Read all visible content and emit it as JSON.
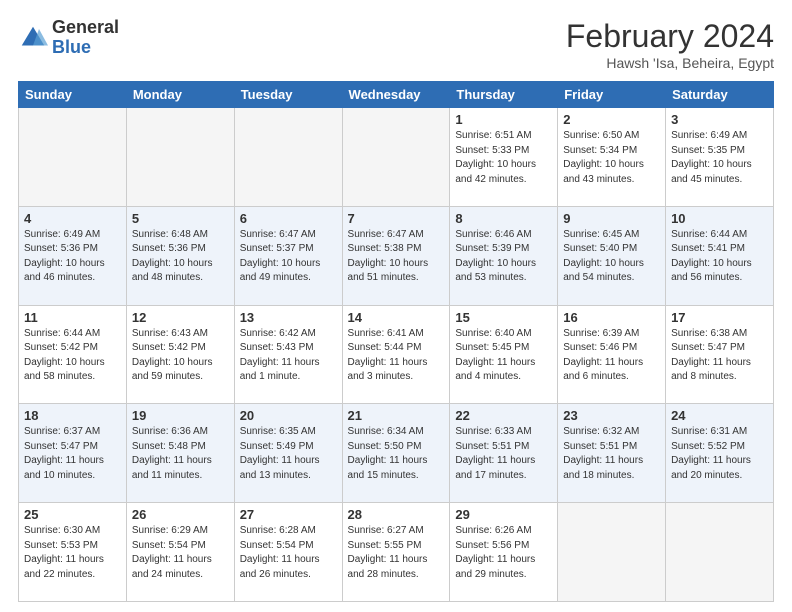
{
  "header": {
    "logo_general": "General",
    "logo_blue": "Blue",
    "month_year": "February 2024",
    "location": "Hawsh 'Isa, Beheira, Egypt"
  },
  "weekdays": [
    "Sunday",
    "Monday",
    "Tuesday",
    "Wednesday",
    "Thursday",
    "Friday",
    "Saturday"
  ],
  "weeks": [
    [
      {
        "day": "",
        "empty": true
      },
      {
        "day": "",
        "empty": true
      },
      {
        "day": "",
        "empty": true
      },
      {
        "day": "",
        "empty": true
      },
      {
        "day": "1",
        "sunrise": "6:51 AM",
        "sunset": "5:33 PM",
        "daylight": "10 hours and 42 minutes."
      },
      {
        "day": "2",
        "sunrise": "6:50 AM",
        "sunset": "5:34 PM",
        "daylight": "10 hours and 43 minutes."
      },
      {
        "day": "3",
        "sunrise": "6:49 AM",
        "sunset": "5:35 PM",
        "daylight": "10 hours and 45 minutes."
      }
    ],
    [
      {
        "day": "4",
        "sunrise": "6:49 AM",
        "sunset": "5:36 PM",
        "daylight": "10 hours and 46 minutes."
      },
      {
        "day": "5",
        "sunrise": "6:48 AM",
        "sunset": "5:36 PM",
        "daylight": "10 hours and 48 minutes."
      },
      {
        "day": "6",
        "sunrise": "6:47 AM",
        "sunset": "5:37 PM",
        "daylight": "10 hours and 49 minutes."
      },
      {
        "day": "7",
        "sunrise": "6:47 AM",
        "sunset": "5:38 PM",
        "daylight": "10 hours and 51 minutes."
      },
      {
        "day": "8",
        "sunrise": "6:46 AM",
        "sunset": "5:39 PM",
        "daylight": "10 hours and 53 minutes."
      },
      {
        "day": "9",
        "sunrise": "6:45 AM",
        "sunset": "5:40 PM",
        "daylight": "10 hours and 54 minutes."
      },
      {
        "day": "10",
        "sunrise": "6:44 AM",
        "sunset": "5:41 PM",
        "daylight": "10 hours and 56 minutes."
      }
    ],
    [
      {
        "day": "11",
        "sunrise": "6:44 AM",
        "sunset": "5:42 PM",
        "daylight": "10 hours and 58 minutes."
      },
      {
        "day": "12",
        "sunrise": "6:43 AM",
        "sunset": "5:42 PM",
        "daylight": "10 hours and 59 minutes."
      },
      {
        "day": "13",
        "sunrise": "6:42 AM",
        "sunset": "5:43 PM",
        "daylight": "11 hours and 1 minute."
      },
      {
        "day": "14",
        "sunrise": "6:41 AM",
        "sunset": "5:44 PM",
        "daylight": "11 hours and 3 minutes."
      },
      {
        "day": "15",
        "sunrise": "6:40 AM",
        "sunset": "5:45 PM",
        "daylight": "11 hours and 4 minutes."
      },
      {
        "day": "16",
        "sunrise": "6:39 AM",
        "sunset": "5:46 PM",
        "daylight": "11 hours and 6 minutes."
      },
      {
        "day": "17",
        "sunrise": "6:38 AM",
        "sunset": "5:47 PM",
        "daylight": "11 hours and 8 minutes."
      }
    ],
    [
      {
        "day": "18",
        "sunrise": "6:37 AM",
        "sunset": "5:47 PM",
        "daylight": "11 hours and 10 minutes."
      },
      {
        "day": "19",
        "sunrise": "6:36 AM",
        "sunset": "5:48 PM",
        "daylight": "11 hours and 11 minutes."
      },
      {
        "day": "20",
        "sunrise": "6:35 AM",
        "sunset": "5:49 PM",
        "daylight": "11 hours and 13 minutes."
      },
      {
        "day": "21",
        "sunrise": "6:34 AM",
        "sunset": "5:50 PM",
        "daylight": "11 hours and 15 minutes."
      },
      {
        "day": "22",
        "sunrise": "6:33 AM",
        "sunset": "5:51 PM",
        "daylight": "11 hours and 17 minutes."
      },
      {
        "day": "23",
        "sunrise": "6:32 AM",
        "sunset": "5:51 PM",
        "daylight": "11 hours and 18 minutes."
      },
      {
        "day": "24",
        "sunrise": "6:31 AM",
        "sunset": "5:52 PM",
        "daylight": "11 hours and 20 minutes."
      }
    ],
    [
      {
        "day": "25",
        "sunrise": "6:30 AM",
        "sunset": "5:53 PM",
        "daylight": "11 hours and 22 minutes."
      },
      {
        "day": "26",
        "sunrise": "6:29 AM",
        "sunset": "5:54 PM",
        "daylight": "11 hours and 24 minutes."
      },
      {
        "day": "27",
        "sunrise": "6:28 AM",
        "sunset": "5:54 PM",
        "daylight": "11 hours and 26 minutes."
      },
      {
        "day": "28",
        "sunrise": "6:27 AM",
        "sunset": "5:55 PM",
        "daylight": "11 hours and 28 minutes."
      },
      {
        "day": "29",
        "sunrise": "6:26 AM",
        "sunset": "5:56 PM",
        "daylight": "11 hours and 29 minutes."
      },
      {
        "day": "",
        "empty": true
      },
      {
        "day": "",
        "empty": true
      }
    ]
  ]
}
